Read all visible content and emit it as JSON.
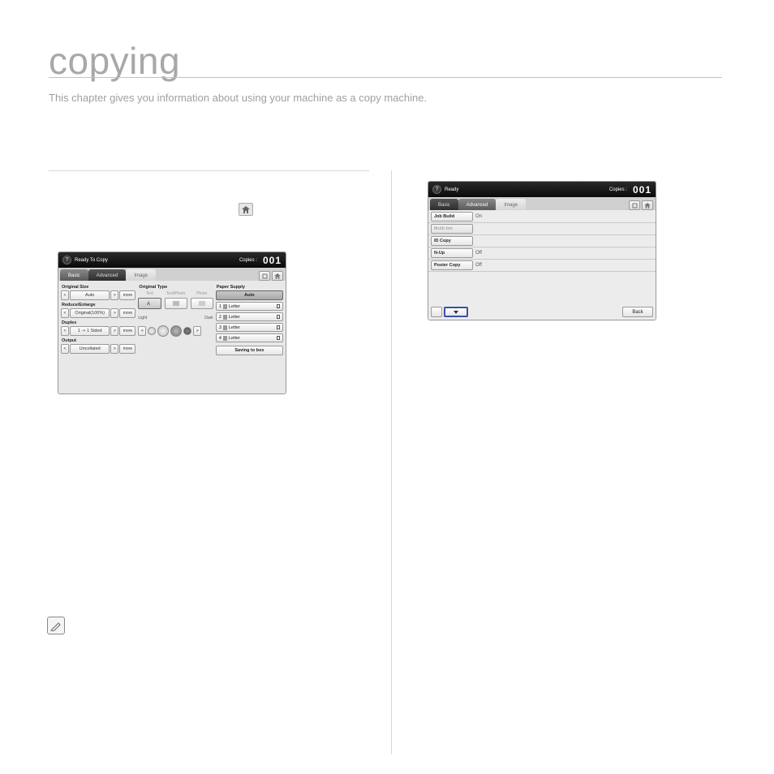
{
  "page": {
    "title": "copying",
    "subtitle": "This chapter gives you information about using your machine as a copy machine."
  },
  "screen1": {
    "header": {
      "status": "Ready To Copy",
      "copies_label": "Copies :",
      "copies": "001"
    },
    "tabs": [
      "Basic",
      "Advanced",
      "Image"
    ],
    "left": {
      "original_size": {
        "label": "Original Size",
        "value": "Auto",
        "more": "more"
      },
      "reduce_enlarge": {
        "label": "Reduce/Enlarge",
        "value": "Original(100%)",
        "more": "more"
      },
      "duplex": {
        "label": "Duplex",
        "value": "1 -> 1 Sided",
        "more": "more"
      },
      "output": {
        "label": "Output",
        "value": "Uncollated",
        "more": "more"
      }
    },
    "mid": {
      "original_type": {
        "label": "Original Type",
        "opts": [
          "Text",
          "Text/Photo",
          "Photo"
        ]
      },
      "darkness": {
        "light": "Light",
        "dark": "Dark"
      }
    },
    "right": {
      "paper_supply": "Paper Supply",
      "auto": "Auto",
      "trays": [
        "1",
        "2",
        "3",
        "4"
      ],
      "tray_label": "Letter",
      "save": "Saving to box"
    }
  },
  "screen2": {
    "header": {
      "status": "Ready",
      "copies_label": "Copies :",
      "copies": "001"
    },
    "tabs": [
      "Basic",
      "Advanced",
      "Image"
    ],
    "rows": [
      {
        "key": "Job Build",
        "val": "On"
      },
      {
        "key": "Multi-bin",
        "val": "",
        "dim": true
      },
      {
        "key": "ID Copy",
        "val": ""
      },
      {
        "key": "N-Up",
        "val": "Off"
      },
      {
        "key": "Poster Copy",
        "val": "Off"
      }
    ],
    "back": "Back"
  }
}
